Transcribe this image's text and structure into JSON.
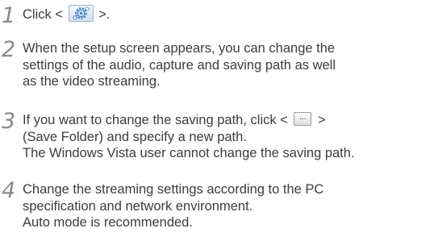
{
  "steps": [
    {
      "number": "1",
      "before": "Click <",
      "icon": "setup-gear-icon",
      "after": ">."
    },
    {
      "number": "2",
      "lines": [
        "When the setup screen appears, you can change the",
        "settings of the audio, capture and saving path as well",
        "as the video streaming."
      ]
    },
    {
      "number": "3",
      "line1_before": "If you want to change the saving path, click <",
      "browse_label": "...",
      "line1_after": ">",
      "lines": [
        "(Save Folder) and specify a new path.",
        "The Windows Vista user cannot change the saving path."
      ]
    },
    {
      "number": "4",
      "lines": [
        "Change the streaming settings according to the PC",
        "specification and network environment.",
        "Auto mode is recommended."
      ]
    }
  ],
  "colors": {
    "text": "#3c3c3c",
    "number": "#8a8a8a",
    "setup_button_border": "#9db3cc",
    "setup_icon": "#3b7bc4"
  }
}
